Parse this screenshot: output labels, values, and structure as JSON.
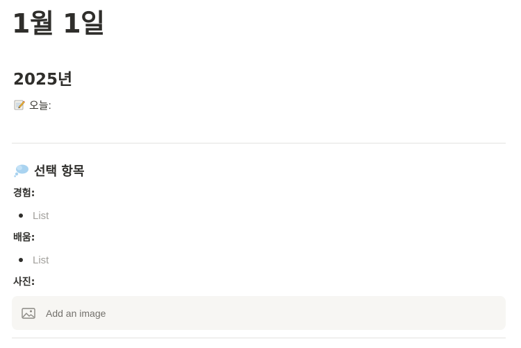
{
  "page": {
    "title": "1월 1일"
  },
  "year_heading": "2025년",
  "today": {
    "icon": "memo-icon",
    "label": "오늘:"
  },
  "section": {
    "icon": "thought-bubble-icon",
    "title": "선택 항목"
  },
  "fields": [
    {
      "label": "경험:",
      "bullet_placeholder": "List"
    },
    {
      "label": "배움:",
      "bullet_placeholder": "List"
    },
    {
      "label": "사진:"
    }
  ],
  "image_block": {
    "icon": "image-icon",
    "label": "Add an image"
  },
  "colors": {
    "text": "#37352f",
    "heading": "#2f2e2b",
    "placeholder": "#a19f9b",
    "divider": "#e3e2e0",
    "block_bg": "#f7f6f3",
    "bubble": "#a9d3f0"
  }
}
